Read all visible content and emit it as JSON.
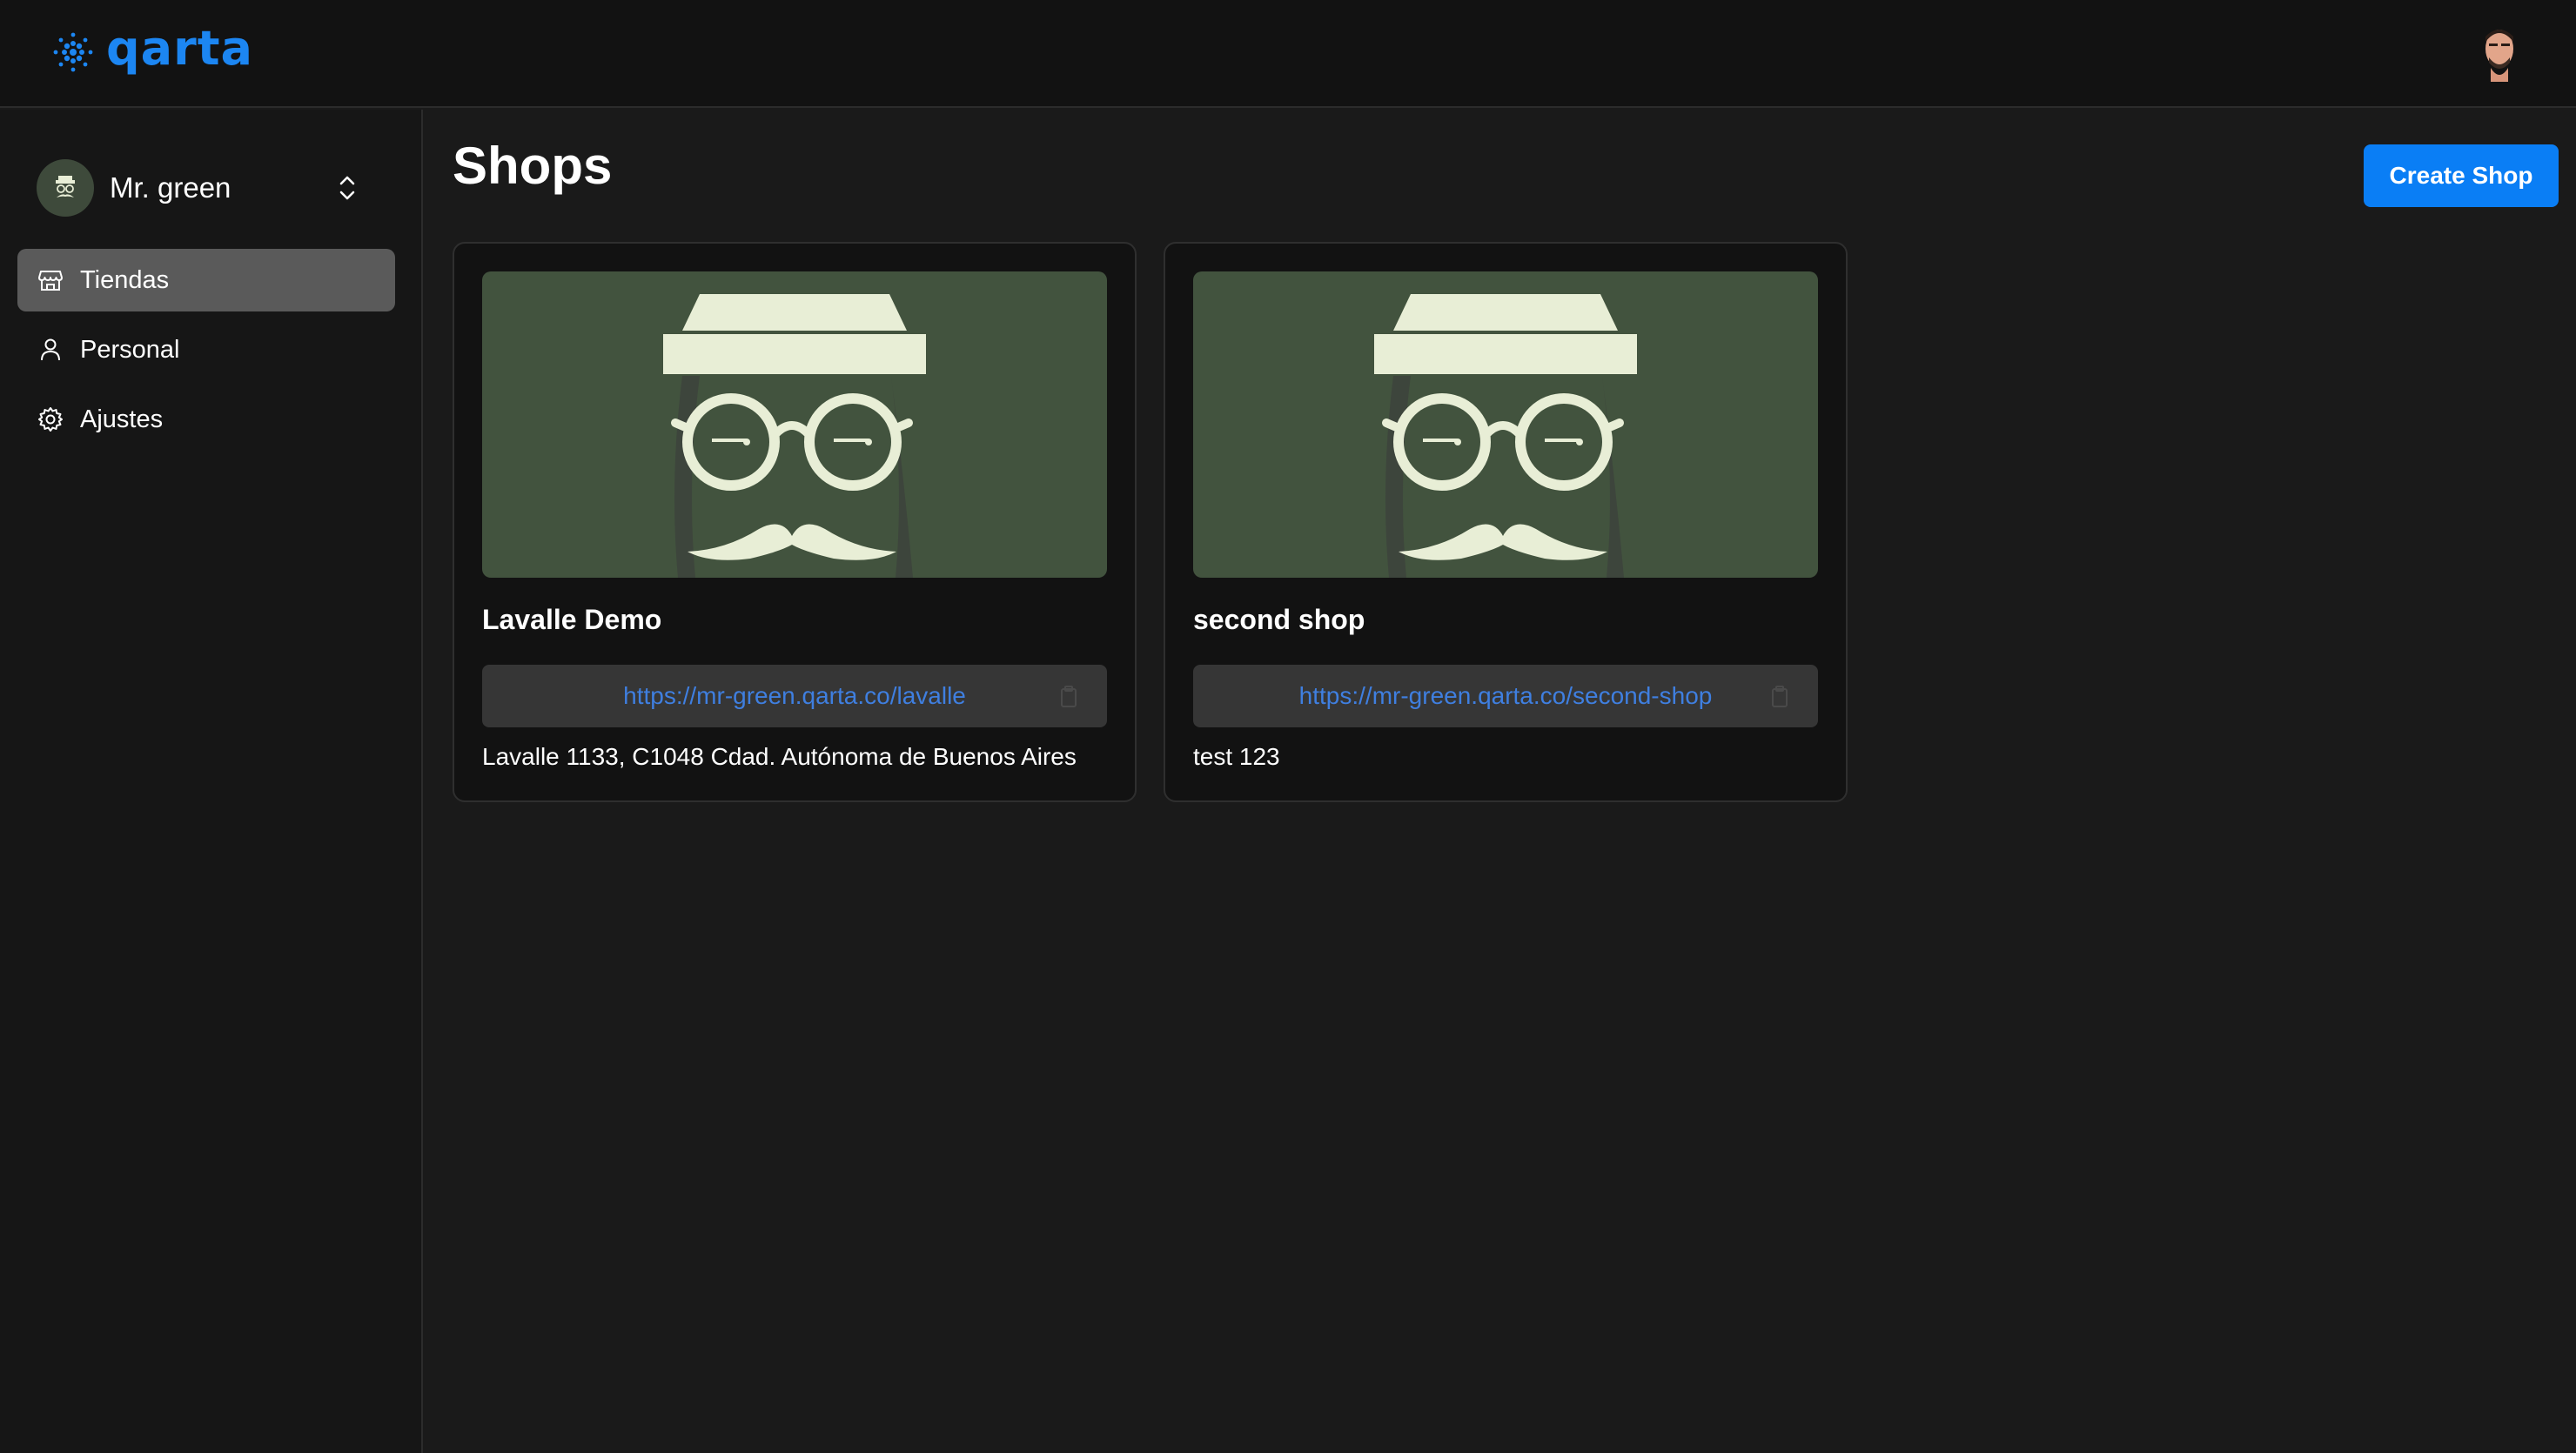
{
  "app": {
    "logo_text": "qarta",
    "brand_color": "#1c86f2"
  },
  "header": {
    "user_avatar": "user-avatar-photo"
  },
  "sidebar": {
    "org": {
      "name": "Mr. green",
      "avatar": "mr-green-logo"
    },
    "items": [
      {
        "label": "Tiendas",
        "icon": "store-icon",
        "active": true
      },
      {
        "label": "Personal",
        "icon": "person-icon",
        "active": false
      },
      {
        "label": "Ajustes",
        "icon": "gear-icon",
        "active": false
      }
    ]
  },
  "main": {
    "title": "Shops",
    "create_button": "Create Shop",
    "shops": [
      {
        "name": "Lavalle Demo",
        "url": "https://mr-green.qarta.co/lavalle",
        "address": "Lavalle 1133, C1048 Cdad. Autónoma de Buenos Aires",
        "image": "mr-green-logo"
      },
      {
        "name": "second shop",
        "url": "https://mr-green.qarta.co/second-shop",
        "address": "test 123",
        "image": "mr-green-logo"
      }
    ]
  },
  "colors": {
    "accent": "#0a7ef5",
    "link": "#3f7fe0",
    "card_image_bg": "#42533e",
    "active_nav_bg": "#5a5a5a"
  }
}
